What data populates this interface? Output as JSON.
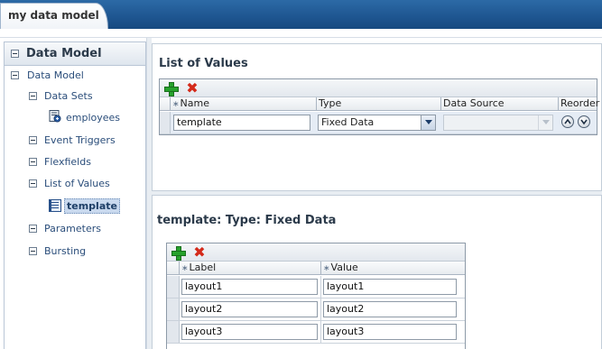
{
  "window": {
    "tab_title": "my data model"
  },
  "sidebar": {
    "title": "Data Model",
    "root": "Data Model",
    "items": [
      {
        "label": "Data Sets"
      },
      {
        "label": "employees"
      },
      {
        "label": "Event Triggers"
      },
      {
        "label": "Flexfields"
      },
      {
        "label": "List of Values"
      },
      {
        "label": "template"
      },
      {
        "label": "Parameters"
      },
      {
        "label": "Bursting"
      }
    ]
  },
  "lov": {
    "title": "List of Values",
    "columns": {
      "name": "Name",
      "type": "Type",
      "data_source": "Data Source",
      "reorder": "Reorder"
    },
    "row": {
      "name": "template",
      "type": "Fixed Data",
      "data_source": ""
    }
  },
  "fixed": {
    "title": "template: Type: Fixed Data",
    "columns": {
      "label": "Label",
      "value": "Value"
    },
    "rows": [
      {
        "label": "layout1",
        "value": "layout1"
      },
      {
        "label": "layout2",
        "value": "layout2"
      },
      {
        "label": "layout3",
        "value": "layout3"
      }
    ]
  },
  "colors": {
    "header_blue": "#1e5590",
    "add_green": "#27a22c",
    "delete_red": "#d42a1a",
    "selection": "#c9d9ee"
  },
  "icons": [
    "collapse-icon",
    "dataset-icon",
    "lov-icon",
    "add-icon",
    "delete-icon",
    "move-up-icon",
    "move-down-icon",
    "dropdown-icon"
  ]
}
